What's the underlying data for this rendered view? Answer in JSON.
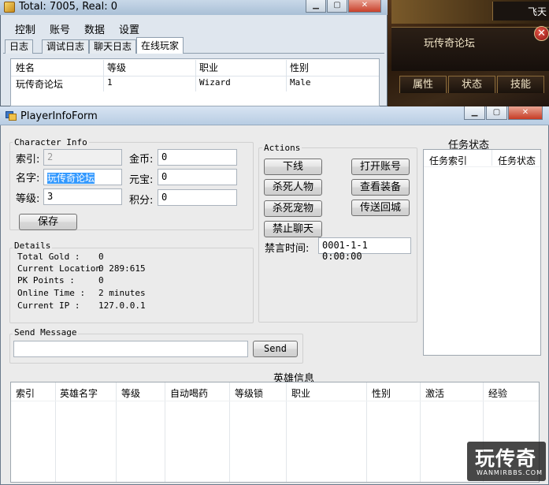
{
  "game": {
    "tag": "飞天",
    "panel_title": "玩传奇论坛",
    "tabs": [
      "属性",
      "状态",
      "技能"
    ]
  },
  "back_window": {
    "title": "Total: 7005, Real: 0",
    "menu": [
      "控制",
      "账号",
      "数据",
      "设置"
    ],
    "tabs": [
      "日志",
      "调试日志",
      "聊天日志",
      "在线玩家"
    ],
    "active_tab": "在线玩家",
    "columns": [
      "姓名",
      "等级",
      "职业",
      "性别"
    ],
    "rows": [
      {
        "name": "玩传奇论坛",
        "level": "1",
        "job": "Wizard",
        "gender": "Male"
      }
    ]
  },
  "dialog": {
    "title": "PlayerInfoForm",
    "character_info": {
      "label": "Character Info",
      "index_label": "索引:",
      "index_value": "2",
      "name_label": "名字:",
      "name_value": "玩传奇论坛",
      "level_label": "等级:",
      "level_value": "3",
      "gold_label": "金币:",
      "gold_value": "0",
      "yuanbao_label": "元宝:",
      "yuanbao_value": "0",
      "points_label": "积分:",
      "points_value": "0",
      "save_label": "保存"
    },
    "details": {
      "label": "Details",
      "rows": [
        {
          "k": "Total Gold   :",
          "v": "0"
        },
        {
          "k": "Current Location",
          "v": "0 289:615"
        },
        {
          "k": "PK Points    :",
          "v": "0"
        },
        {
          "k": "Online Time  :",
          "v": "2 minutes"
        },
        {
          "k": "Current IP   :",
          "v": "127.0.0.1"
        }
      ]
    },
    "actions": {
      "label": "Actions",
      "kick": "下线",
      "open_account": "打开账号",
      "kill_player": "杀死人物",
      "view_equipment": "查看装备",
      "kill_pet": "杀死宠物",
      "teleport_home": "传送回城",
      "ban_chat": "禁止聊天",
      "ban_time_label": "禁言时间:",
      "ban_time_value": "0001-1-1 0:00:00"
    },
    "send_message": {
      "label": "Send Message",
      "value": "",
      "send_label": "Send"
    },
    "quest": {
      "title": "任务状态",
      "columns": [
        "任务索引",
        "任务状态"
      ]
    },
    "hero": {
      "title": "英雄信息",
      "columns": [
        "索引",
        "英雄名字",
        "等级",
        "自动喝药",
        "等级锁",
        "职业",
        "性别",
        "激活",
        "经验"
      ]
    }
  },
  "watermark": {
    "main": "玩传奇",
    "sub": "WANMIRBBS.COM"
  }
}
